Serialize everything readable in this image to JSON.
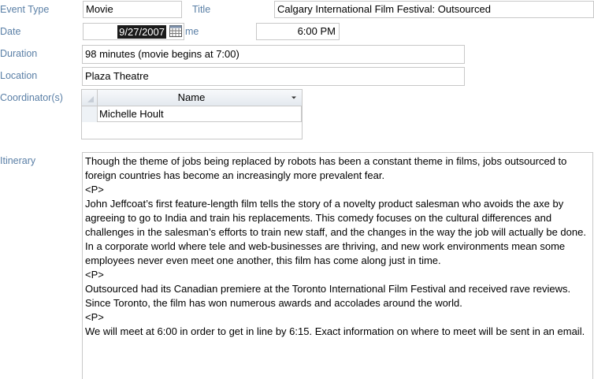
{
  "form": {
    "event_type": {
      "label": "Event Type",
      "value": "Movie"
    },
    "title": {
      "label": "Title",
      "value": "Calgary International Film Festival: Outsourced"
    },
    "date": {
      "label": "Date",
      "value": "9/27/2007"
    },
    "time": {
      "label": "me",
      "value": "6:00 PM"
    },
    "duration": {
      "label": "Duration",
      "value": "98 minutes (movie begins at 7:00)"
    },
    "location": {
      "label": "Location",
      "value": "Plaza Theatre"
    },
    "coordinators": {
      "label": "Coordinator(s)",
      "column_header": "Name",
      "rows": [
        {
          "name": "Michelle Hoult"
        }
      ]
    },
    "itinerary": {
      "label": "Itinerary",
      "paragraphs": [
        "Though the theme of jobs being replaced by robots has been a constant theme in films, jobs outsourced to foreign countries has become an increasingly more prevalent fear.",
        "<P>",
        "John Jeffcoat’s first feature-length film tells the story of a novelty product salesman who avoids the axe by agreeing to go to India and train his replacements. This comedy focuses on the cultural differences and challenges in the salesman’s efforts to train new staff, and the changes in the way the job will actually be done. In a corporate world where tele and web-businesses are thriving, and new work environments mean some employees never even meet one another, this film has come along just in time.",
        "<P>",
        "Outsourced had its Canadian premiere at the Toronto International Film Festival and received rave reviews. Since Toronto, the film has won numerous awards and accolades around the world.",
        "<P>",
        "We will meet at 6:00 in order to get in line by 6:15.  Exact information on where to meet will be sent in an email."
      ]
    }
  },
  "icons": {
    "date_picker": "calendar-icon",
    "column_menu": "dropdown-arrow-icon"
  },
  "colors": {
    "label": "#5a7fa6",
    "border": "#c8c8c8",
    "selection": "#1a1a1a"
  }
}
